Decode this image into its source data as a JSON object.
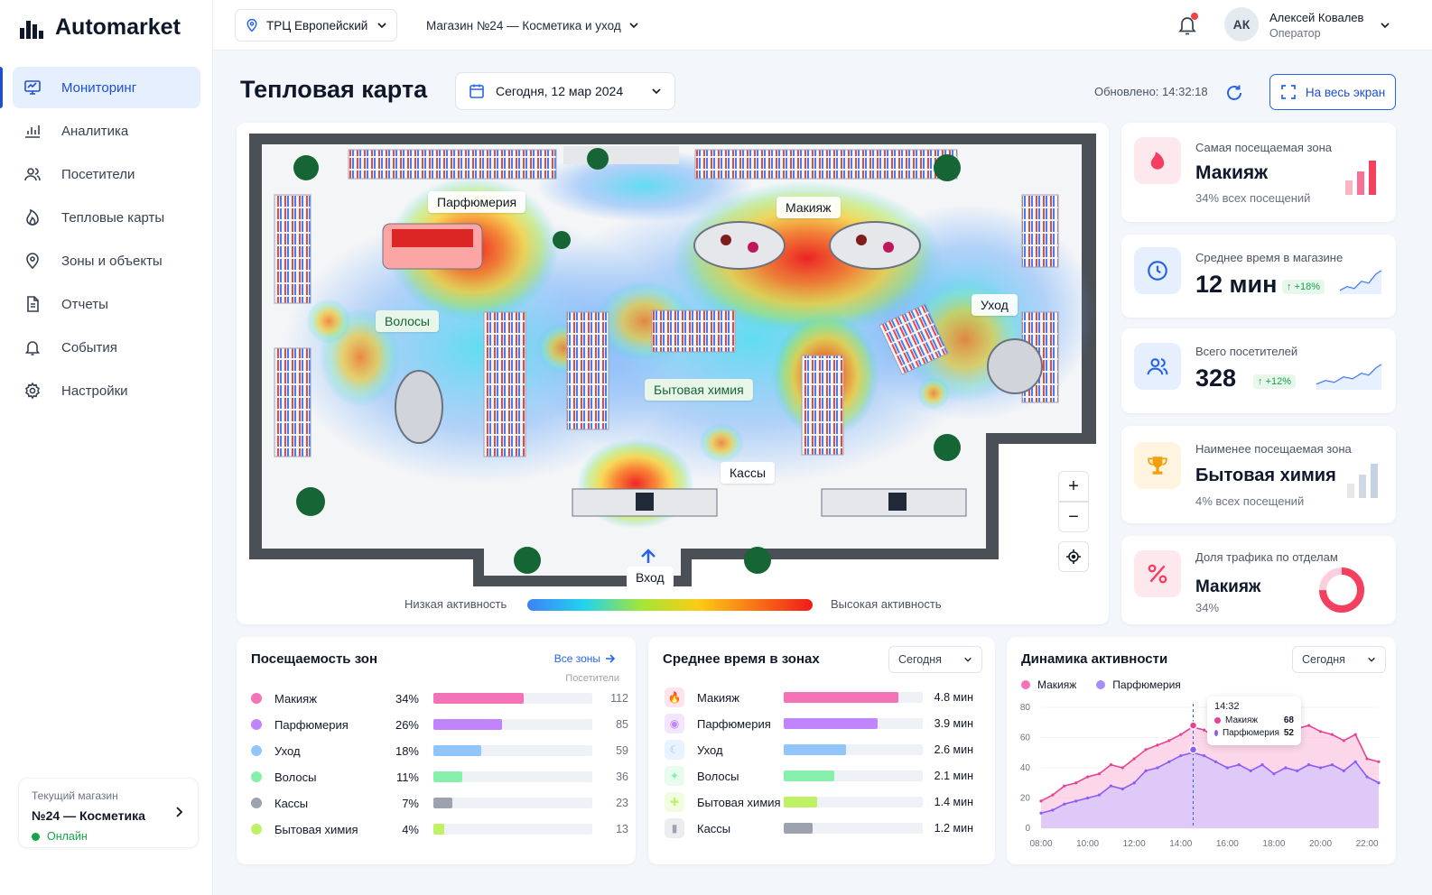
{
  "app": {
    "name": "Automarket"
  },
  "nav": [
    {
      "label": "Мониторинг",
      "icon": "monitor-icon",
      "active": true
    },
    {
      "label": "Аналитика",
      "icon": "bar-chart-icon"
    },
    {
      "label": "Посетители",
      "icon": "users-icon"
    },
    {
      "label": "Тепловые карты",
      "icon": "flame-icon"
    },
    {
      "label": "Зоны и объекты",
      "icon": "map-pin-icon"
    },
    {
      "label": "Отчеты",
      "icon": "document-icon"
    },
    {
      "label": "События",
      "icon": "bell-icon"
    },
    {
      "label": "Настройки",
      "icon": "gear-icon"
    }
  ],
  "store_card": {
    "caption": "Текущий магазин",
    "name": "№24 — Косметика",
    "status": "Онлайн"
  },
  "topbar": {
    "location": "ТРЦ Европейский",
    "shop": "Магазин №24 — Косметика и уход",
    "user": {
      "initials": "АК",
      "name": "Алексей Ковалев",
      "role": "Оператор"
    }
  },
  "page": {
    "title": "Тепловая карта",
    "date": "Сегодня, 12 мар 2024",
    "updated": "Обновлено: 14:32:18",
    "fullscreen": "На весь экран"
  },
  "map": {
    "zones": [
      "Парфюмерия",
      "Макияж",
      "Уход",
      "Волосы",
      "Бытовая химия",
      "Кассы",
      "Вход"
    ],
    "zoom_in": "+",
    "zoom_out": "−",
    "legend_low": "Низкая активность",
    "legend_high": "Высокая активность"
  },
  "kpis": [
    {
      "label": "Самая посещаемая зона",
      "value": "Макияж",
      "sub": "34% всех посещений",
      "icon": "flame-icon",
      "color": "#f43f5e"
    },
    {
      "label": "Среднее время в магазине",
      "value": "12 мин",
      "change": "+18%",
      "icon": "clock-icon",
      "color": "#2563eb"
    },
    {
      "label": "Всего посетителей",
      "value": "328",
      "change": "+12%",
      "icon": "users-icon",
      "color": "#2563eb"
    },
    {
      "label": "Наименее посещаемая зона",
      "value": "Бытовая химия",
      "sub": "4% всех посещений",
      "icon": "trophy-icon",
      "color": "#f59e0b"
    },
    {
      "label": "Доля трафика по отделам",
      "value": "Макияж",
      "sub": "34%",
      "share": 0.34,
      "icon": "percent-icon",
      "color": "#f43f5e"
    }
  ],
  "zones_card": {
    "title": "Посещаемость зон",
    "link": "Все зоны",
    "column": "Посетители",
    "rows": [
      {
        "name": "Макияж",
        "percent": "34%",
        "count": "112",
        "share": 0.34,
        "color": "#f472b6"
      },
      {
        "name": "Парфюмерия",
        "percent": "26%",
        "count": "85",
        "share": 0.26,
        "color": "#c084fc"
      },
      {
        "name": "Уход",
        "percent": "18%",
        "count": "59",
        "share": 0.18,
        "color": "#93c5fd"
      },
      {
        "name": "Волосы",
        "percent": "11%",
        "count": "36",
        "share": 0.11,
        "color": "#86efac"
      },
      {
        "name": "Кассы",
        "percent": "7%",
        "count": "23",
        "share": 0.07,
        "color": "#9ca3af"
      },
      {
        "name": "Бытовая химия",
        "percent": "4%",
        "count": "13",
        "share": 0.04,
        "color": "#bef264"
      }
    ]
  },
  "time_card": {
    "title": "Среднее время в зонах",
    "period": "Сегодня",
    "rows": [
      {
        "name": "Макияж",
        "time": "4.8 мин",
        "minutes": 4.8,
        "color": "#f472b6",
        "icon": "flame-icon"
      },
      {
        "name": "Парфюмерия",
        "time": "3.9 мин",
        "minutes": 3.9,
        "color": "#c084fc",
        "icon": "perfume-icon"
      },
      {
        "name": "Уход",
        "time": "2.6 мин",
        "minutes": 2.6,
        "color": "#93c5fd",
        "icon": "care-icon"
      },
      {
        "name": "Волосы",
        "time": "2.1 мин",
        "minutes": 2.1,
        "color": "#86efac",
        "icon": "hair-icon"
      },
      {
        "name": "Бытовая химия",
        "time": "1.4 мин",
        "minutes": 1.4,
        "color": "#bef264",
        "icon": "spray-icon"
      },
      {
        "name": "Кассы",
        "time": "1.2 мин",
        "minutes": 1.2,
        "color": "#9ca3af",
        "icon": "cashier-icon"
      }
    ]
  },
  "activity_card": {
    "title": "Динамика активности",
    "period": "Сегодня",
    "tooltip": {
      "time": "14:32",
      "rows": [
        {
          "name": "Макияж",
          "value": "68"
        },
        {
          "name": "Парфюмерия",
          "value": "52"
        }
      ]
    }
  },
  "chart_data": {
    "type": "area",
    "title": "Динамика активности",
    "x": [
      "08:00",
      "08:30",
      "09:00",
      "09:30",
      "10:00",
      "10:30",
      "11:00",
      "11:30",
      "12:00",
      "12:30",
      "13:00",
      "13:30",
      "14:00",
      "14:30",
      "15:00",
      "15:30",
      "16:00",
      "16:30",
      "17:00",
      "17:30",
      "18:00",
      "18:30",
      "19:00",
      "19:30",
      "20:00",
      "20:30",
      "21:00",
      "21:30",
      "22:00",
      "22:30"
    ],
    "xticks": [
      "08:00",
      "10:00",
      "12:00",
      "14:00",
      "16:00",
      "18:00",
      "20:00",
      "22:00"
    ],
    "yticks": [
      0,
      20,
      40,
      60,
      80
    ],
    "ylim": [
      0,
      80
    ],
    "series": [
      {
        "name": "Макияж",
        "color": "#e84393",
        "values": [
          18,
          22,
          28,
          30,
          34,
          36,
          42,
          40,
          46,
          52,
          55,
          58,
          62,
          67,
          65,
          60,
          58,
          62,
          66,
          64,
          60,
          62,
          66,
          68,
          64,
          62,
          58,
          62,
          46,
          44
        ]
      },
      {
        "name": "Парфюмерия",
        "color": "#8b5cf6",
        "values": [
          10,
          12,
          16,
          18,
          20,
          22,
          28,
          26,
          30,
          38,
          40,
          44,
          48,
          50,
          48,
          44,
          40,
          42,
          38,
          42,
          36,
          40,
          38,
          42,
          40,
          42,
          38,
          44,
          34,
          30
        ]
      }
    ],
    "marker": {
      "x": "14:32",
      "values": [
        68,
        52
      ]
    },
    "grid": true,
    "legend": "top-left"
  }
}
